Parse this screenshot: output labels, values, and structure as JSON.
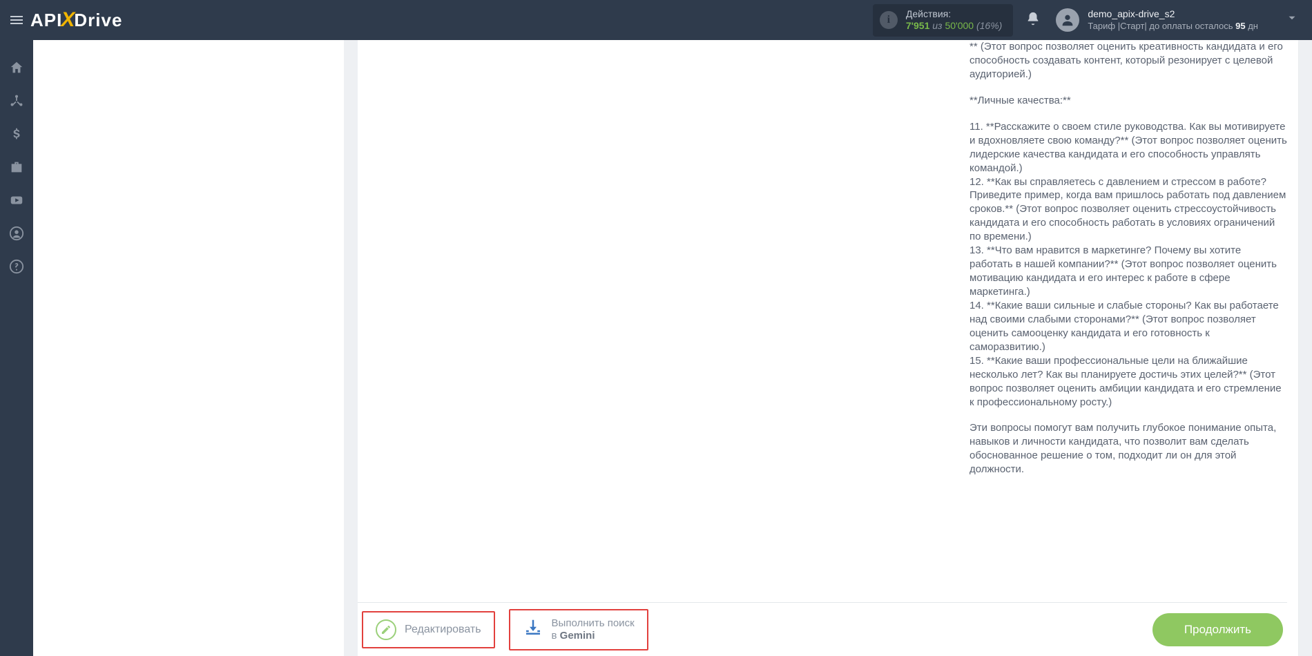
{
  "header": {
    "actions_label": "Действия:",
    "actions_used": "7'951",
    "actions_sep": "из",
    "actions_total": "50'000",
    "actions_pct": "(16%)",
    "user_name": "demo_apix-drive_s2",
    "tariff_prefix": "Тариф |Старт| до оплаты осталось ",
    "tariff_days": "95",
    "tariff_suffix": " дн"
  },
  "logo": {
    "api": "API",
    "x": "X",
    "drive": "Drive"
  },
  "content": {
    "intro_tail": "** (Этот вопрос позволяет оценить креативность кандидата и его способность создавать контент, который резонирует с целевой аудиторией.)",
    "section": "**Личные качества:**",
    "q11": "11. **Расскажите о своем стиле руководства. Как вы мотивируете и вдохновляете свою команду?** (Этот вопрос позволяет оценить лидерские качества кандидата и его способность управлять командой.)",
    "q12": "12. **Как вы справляетесь с давлением и стрессом в работе? Приведите пример, когда вам пришлось работать под давлением сроков.** (Этот вопрос позволяет оценить стрессоустойчивость кандидата и его способность работать в условиях ограничений по времени.)",
    "q13": "13. **Что вам нравится в маркетинге? Почему вы хотите работать в нашей компании?** (Этот вопрос позволяет оценить мотивацию кандидата и его интерес к работе в сфере маркетинга.)",
    "q14": "14. **Какие ваши сильные и слабые стороны? Как вы работаете над своими слабыми сторонами?** (Этот вопрос позволяет оценить самооценку кандидата и его готовность к саморазвитию.)",
    "q15": "15. **Какие ваши профессиональные цели на ближайшие несколько лет? Как вы планируете достичь этих целей?** (Этот вопрос позволяет оценить амбиции кандидата и его стремление к профессиональному росту.)",
    "closing": "Эти вопросы помогут вам получить глубокое понимание опыта, навыков и личности кандидата, что позволит вам сделать обоснованное решение о том, подходит ли он для этой должности."
  },
  "buttons": {
    "edit": "Редактировать",
    "search_line1": "Выполнить поиск",
    "search_line2_prefix": "в ",
    "search_line2_bold": "Gemini",
    "continue": "Продолжить"
  }
}
